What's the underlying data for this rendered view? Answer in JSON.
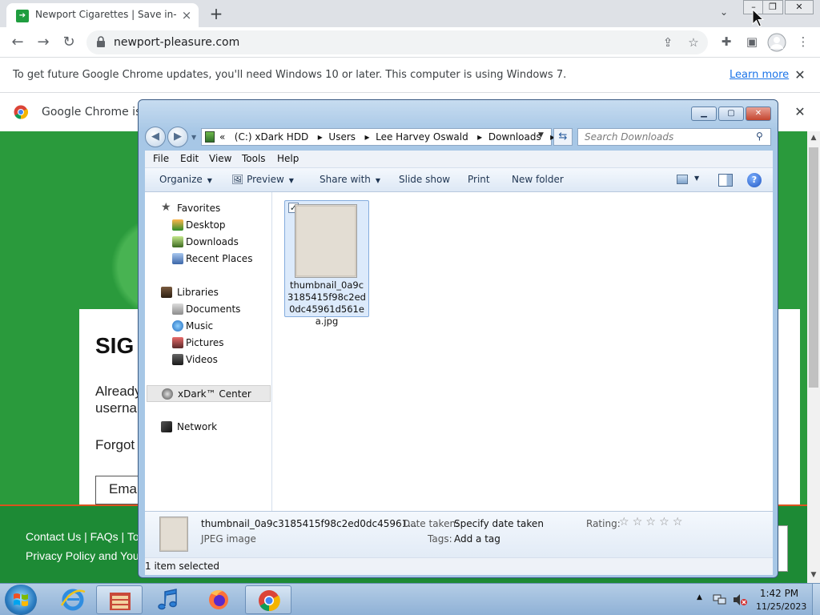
{
  "browser": {
    "tab_title": "Newport Cigarettes | Save in-sto",
    "tab_close": "×",
    "new_tab": "+",
    "url": "newport-pleasure.com",
    "infobar_update": "To get future Google Chrome updates, you'll need Windows 10 or later. This computer is using Windows 7.",
    "learn_more": "Learn more",
    "infobar_default": "Google Chrome isn't",
    "close_glyph": "✕"
  },
  "page": {
    "signin_title": "SIG",
    "already": "Already\nusernar",
    "already_line1": "Already",
    "already_line2": "userna",
    "forgot": "Forgot",
    "email_label": "Emai",
    "footer_links1": "Contact Us  |  FAQs  |  To",
    "footer_links2": "Privacy Policy and Your"
  },
  "explorer": {
    "address_prefix": "«",
    "address_path": [
      "(C:) xDark HDD",
      "Users",
      "Lee Harvey Oswald",
      "Downloads"
    ],
    "search_placeholder": "Search Downloads",
    "menu": [
      "File",
      "Edit",
      "View",
      "Tools",
      "Help"
    ],
    "commands": {
      "organize": "Organize",
      "preview": "Preview",
      "share_with": "Share with",
      "slide_show": "Slide show",
      "print": "Print",
      "new_folder": "New folder"
    },
    "nav": {
      "favorites": "Favorites",
      "desktop": "Desktop",
      "downloads": "Downloads",
      "recent_places": "Recent Places",
      "libraries": "Libraries",
      "documents": "Documents",
      "music": "Music",
      "pictures": "Pictures",
      "videos": "Videos",
      "xdark_center": "xDark™ Center",
      "network": "Network"
    },
    "file": {
      "name": "thumbnail_0a9c3185415f98c2ed0dc45961d561ea.jpg",
      "checked": "✓"
    },
    "details": {
      "name": "thumbnail_0a9c3185415f98c2ed0dc45961...",
      "type": "JPEG image",
      "date_taken_label": "Date taken:",
      "date_taken_value": "Specify date taken",
      "tags_label": "Tags:",
      "tags_value": "Add a tag",
      "rating_label": "Rating:",
      "rating_stars": 0
    },
    "status": "1 item selected"
  },
  "taskbar": {
    "time": "1:42 PM",
    "date": "11/25/2023"
  },
  "colors": {
    "page_green": "#2a9a3c",
    "footer_green": "#1d8a35",
    "link_blue": "#1a73e8",
    "selection_blue": "#dceafb"
  }
}
